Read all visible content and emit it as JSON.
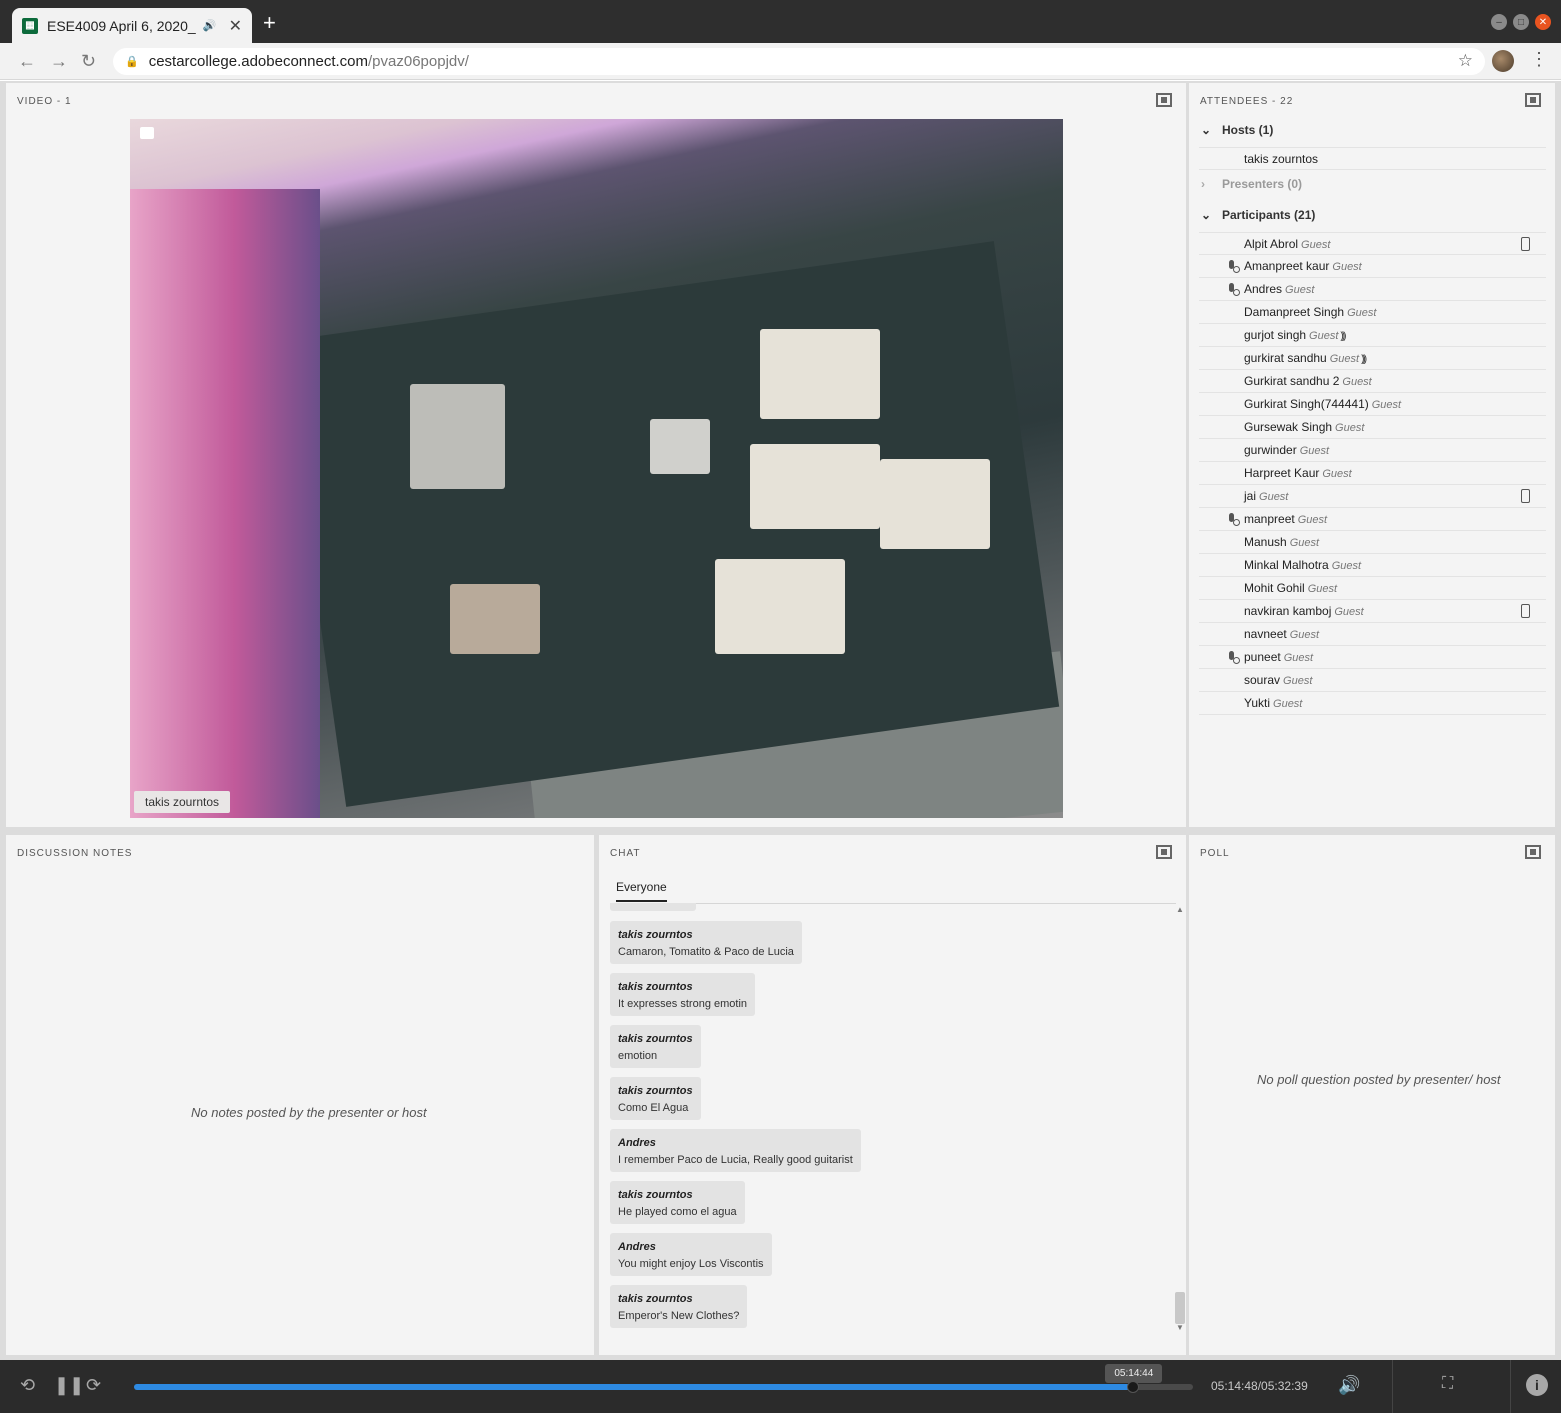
{
  "browser": {
    "tab_title": "ESE4009 April 6, 2020_",
    "url_host": "cestarcollege.adobeconnect.com",
    "url_path": "/pvaz06popjdv/",
    "icons": [
      "back-icon",
      "forward-icon",
      "reload-icon",
      "lock-icon",
      "star-icon",
      "menu-dots-icon",
      "audio-icon",
      "close-icon",
      "new-tab-icon"
    ]
  },
  "video_pod": {
    "title": "VIDEO - 1",
    "presenter_tag": "takis zourntos"
  },
  "attendees_pod": {
    "title": "ATTENDEES - 22",
    "hosts_header": "Hosts (1)",
    "hosts": [
      "takis zourntos"
    ],
    "presenters_header": "Presenters (0)",
    "participants_header": "Participants (21)",
    "participants": [
      {
        "name": "Alpit Abrol",
        "role": "Guest",
        "mic": false,
        "phone": true,
        "speaking": false
      },
      {
        "name": "Amanpreet kaur",
        "role": "Guest",
        "mic": true,
        "phone": false,
        "speaking": false
      },
      {
        "name": "Andres",
        "role": "Guest",
        "mic": true,
        "phone": false,
        "speaking": false
      },
      {
        "name": "Damanpreet Singh",
        "role": "Guest",
        "mic": false,
        "phone": false,
        "speaking": false
      },
      {
        "name": "gurjot singh",
        "role": "Guest",
        "mic": false,
        "phone": false,
        "speaking": true
      },
      {
        "name": "gurkirat sandhu",
        "role": "Guest",
        "mic": false,
        "phone": false,
        "speaking": true
      },
      {
        "name": "Gurkirat sandhu 2",
        "role": "Guest",
        "mic": false,
        "phone": false,
        "speaking": false
      },
      {
        "name": "Gurkirat Singh(744441)",
        "role": "Guest",
        "mic": false,
        "phone": false,
        "speaking": false
      },
      {
        "name": "Gursewak Singh",
        "role": "Guest",
        "mic": false,
        "phone": false,
        "speaking": false
      },
      {
        "name": "gurwinder",
        "role": "Guest",
        "mic": false,
        "phone": false,
        "speaking": false
      },
      {
        "name": "Harpreet Kaur",
        "role": "Guest",
        "mic": false,
        "phone": false,
        "speaking": false
      },
      {
        "name": "jai",
        "role": "Guest",
        "mic": false,
        "phone": true,
        "speaking": false
      },
      {
        "name": "manpreet",
        "role": "Guest",
        "mic": true,
        "phone": false,
        "speaking": false
      },
      {
        "name": "Manush",
        "role": "Guest",
        "mic": false,
        "phone": false,
        "speaking": false
      },
      {
        "name": "Minkal Malhotra",
        "role": "Guest",
        "mic": false,
        "phone": false,
        "speaking": false
      },
      {
        "name": "Mohit Gohil",
        "role": "Guest",
        "mic": false,
        "phone": false,
        "speaking": false
      },
      {
        "name": "navkiran kamboj",
        "role": "Guest",
        "mic": false,
        "phone": true,
        "speaking": false
      },
      {
        "name": "navneet",
        "role": "Guest",
        "mic": false,
        "phone": false,
        "speaking": false
      },
      {
        "name": "puneet",
        "role": "Guest",
        "mic": true,
        "phone": false,
        "speaking": false
      },
      {
        "name": "sourav",
        "role": "Guest",
        "mic": false,
        "phone": false,
        "speaking": false
      },
      {
        "name": "Yukti",
        "role": "Guest",
        "mic": false,
        "phone": false,
        "speaking": false
      }
    ]
  },
  "notes_pod": {
    "title": "DISCUSSION NOTES",
    "empty_text": "No notes posted by the presenter or host"
  },
  "chat_pod": {
    "title": "CHAT",
    "tab": "Everyone",
    "messages": [
      {
        "author": "takis zourntos",
        "text": "Camaron, Tomatito & Paco de Lucia"
      },
      {
        "author": "takis zourntos",
        "text": "It expresses strong emotin"
      },
      {
        "author": "takis zourntos",
        "text": "emotion"
      },
      {
        "author": "takis zourntos",
        "text": "Como El Agua"
      },
      {
        "author": "Andres",
        "text": "I remember Paco de Lucia, Really good guitarist"
      },
      {
        "author": "takis zourntos",
        "text": "He played como el agua"
      },
      {
        "author": "Andres",
        "text": "You might enjoy Los Viscontis"
      },
      {
        "author": "takis zourntos",
        "text": "Emperor's New Clothes?"
      }
    ]
  },
  "poll_pod": {
    "title": "POLL",
    "empty_text": "No poll question posted by presenter/ host"
  },
  "playback": {
    "tooltip_time": "05:14:44",
    "time_display": "05:14:48/05:32:39",
    "progress_fraction": 0.9437,
    "accent_color": "#2d8ae3"
  }
}
